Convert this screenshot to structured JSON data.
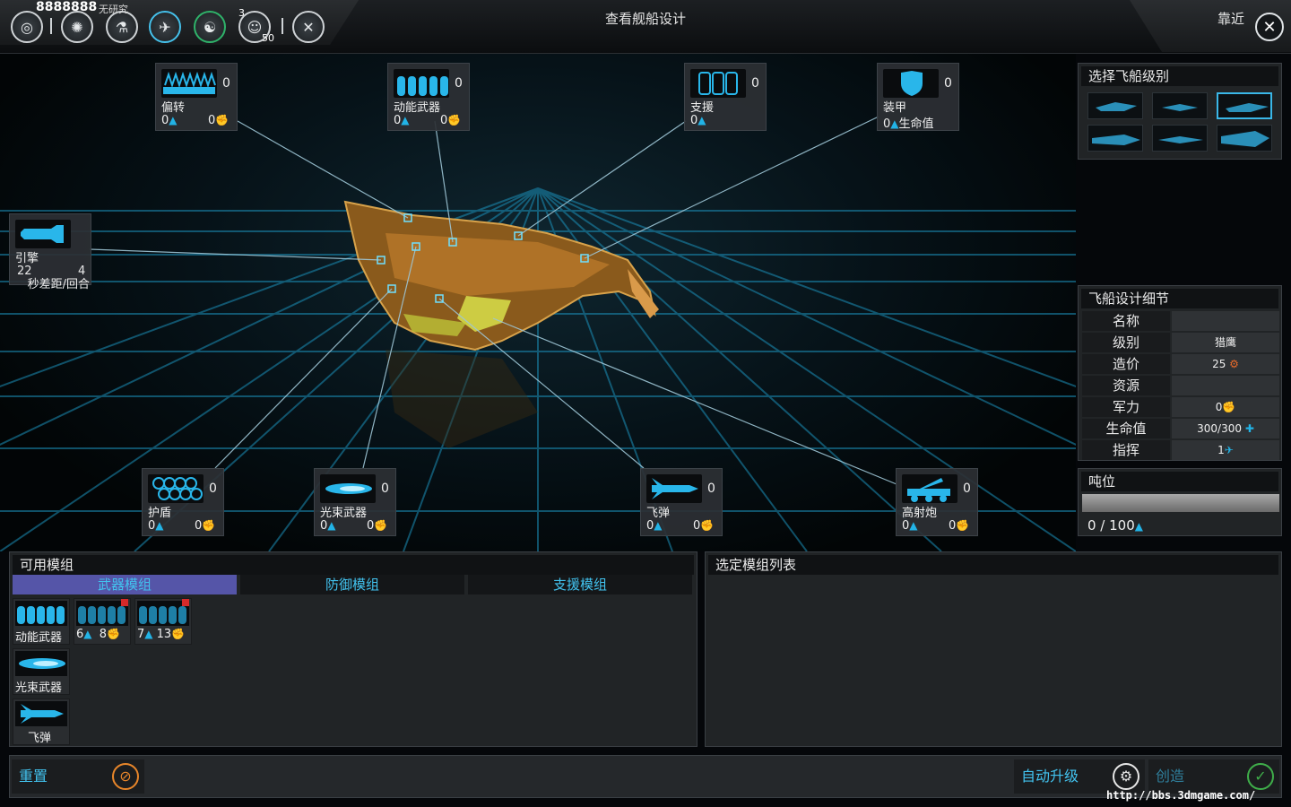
{
  "topbar": {
    "money": "8888888",
    "research": "无研究",
    "title": "查看舰船设计",
    "approach": "靠近",
    "badge_top": "3",
    "badge_bottom": "50"
  },
  "slots": {
    "deflect": {
      "name": "偏转",
      "count": "0",
      "stat_l": "0",
      "stat_r": "0"
    },
    "kinetic": {
      "name": "动能武器",
      "count": "0",
      "stat_l": "0",
      "stat_r": "0"
    },
    "support": {
      "name": "支援",
      "count": "0",
      "stat_l": "0"
    },
    "armor": {
      "name": "装甲",
      "count": "0",
      "stat_l": "0",
      "hp_label": "生命值"
    },
    "engine": {
      "name": "引擎",
      "v1": "22",
      "v2": "4",
      "unit": "秒差距/回合"
    },
    "shield": {
      "name": "护盾",
      "count": "0",
      "stat_l": "0",
      "stat_r": "0"
    },
    "beam": {
      "name": "光束武器",
      "count": "0",
      "stat_l": "0",
      "stat_r": "0"
    },
    "missile": {
      "name": "飞弹",
      "count": "0",
      "stat_l": "0",
      "stat_r": "0"
    },
    "flak": {
      "name": "高射炮",
      "count": "0",
      "stat_l": "0",
      "stat_r": "0"
    }
  },
  "class_panel": {
    "title": "选择飞船级别",
    "selected_index": 2
  },
  "detail_panel": {
    "title": "飞船设计细节",
    "rows": [
      {
        "k": "名称",
        "v": ""
      },
      {
        "k": "级别",
        "v": "猎鹰"
      },
      {
        "k": "造价",
        "v": "25"
      },
      {
        "k": "资源",
        "v": ""
      },
      {
        "k": "军力",
        "v": "0"
      },
      {
        "k": "生命值",
        "v": "300/300"
      },
      {
        "k": "指挥",
        "v": "1"
      }
    ]
  },
  "tonnage": {
    "title": "吨位",
    "value": "0 / 100"
  },
  "modules": {
    "title": "可用模组",
    "tabs": [
      "武器模组",
      "防御模组",
      "支援模组"
    ],
    "items": [
      {
        "label": "动能武器"
      },
      {
        "v1": "6",
        "v2": "8"
      },
      {
        "v1": "7",
        "v2": "13"
      },
      {
        "label": "光束武器"
      },
      {
        "label": "飞弹"
      }
    ]
  },
  "selected_list": {
    "title": "选定模组列表"
  },
  "actions": {
    "reset": "重置",
    "auto_upgrade": "自动升级",
    "create": "创造"
  },
  "watermark": "http://bbs.3dmgame.com/",
  "colors": {
    "accent": "#42c3ef",
    "selected_tab": "#5555a8",
    "ship": "#c98a2a"
  }
}
